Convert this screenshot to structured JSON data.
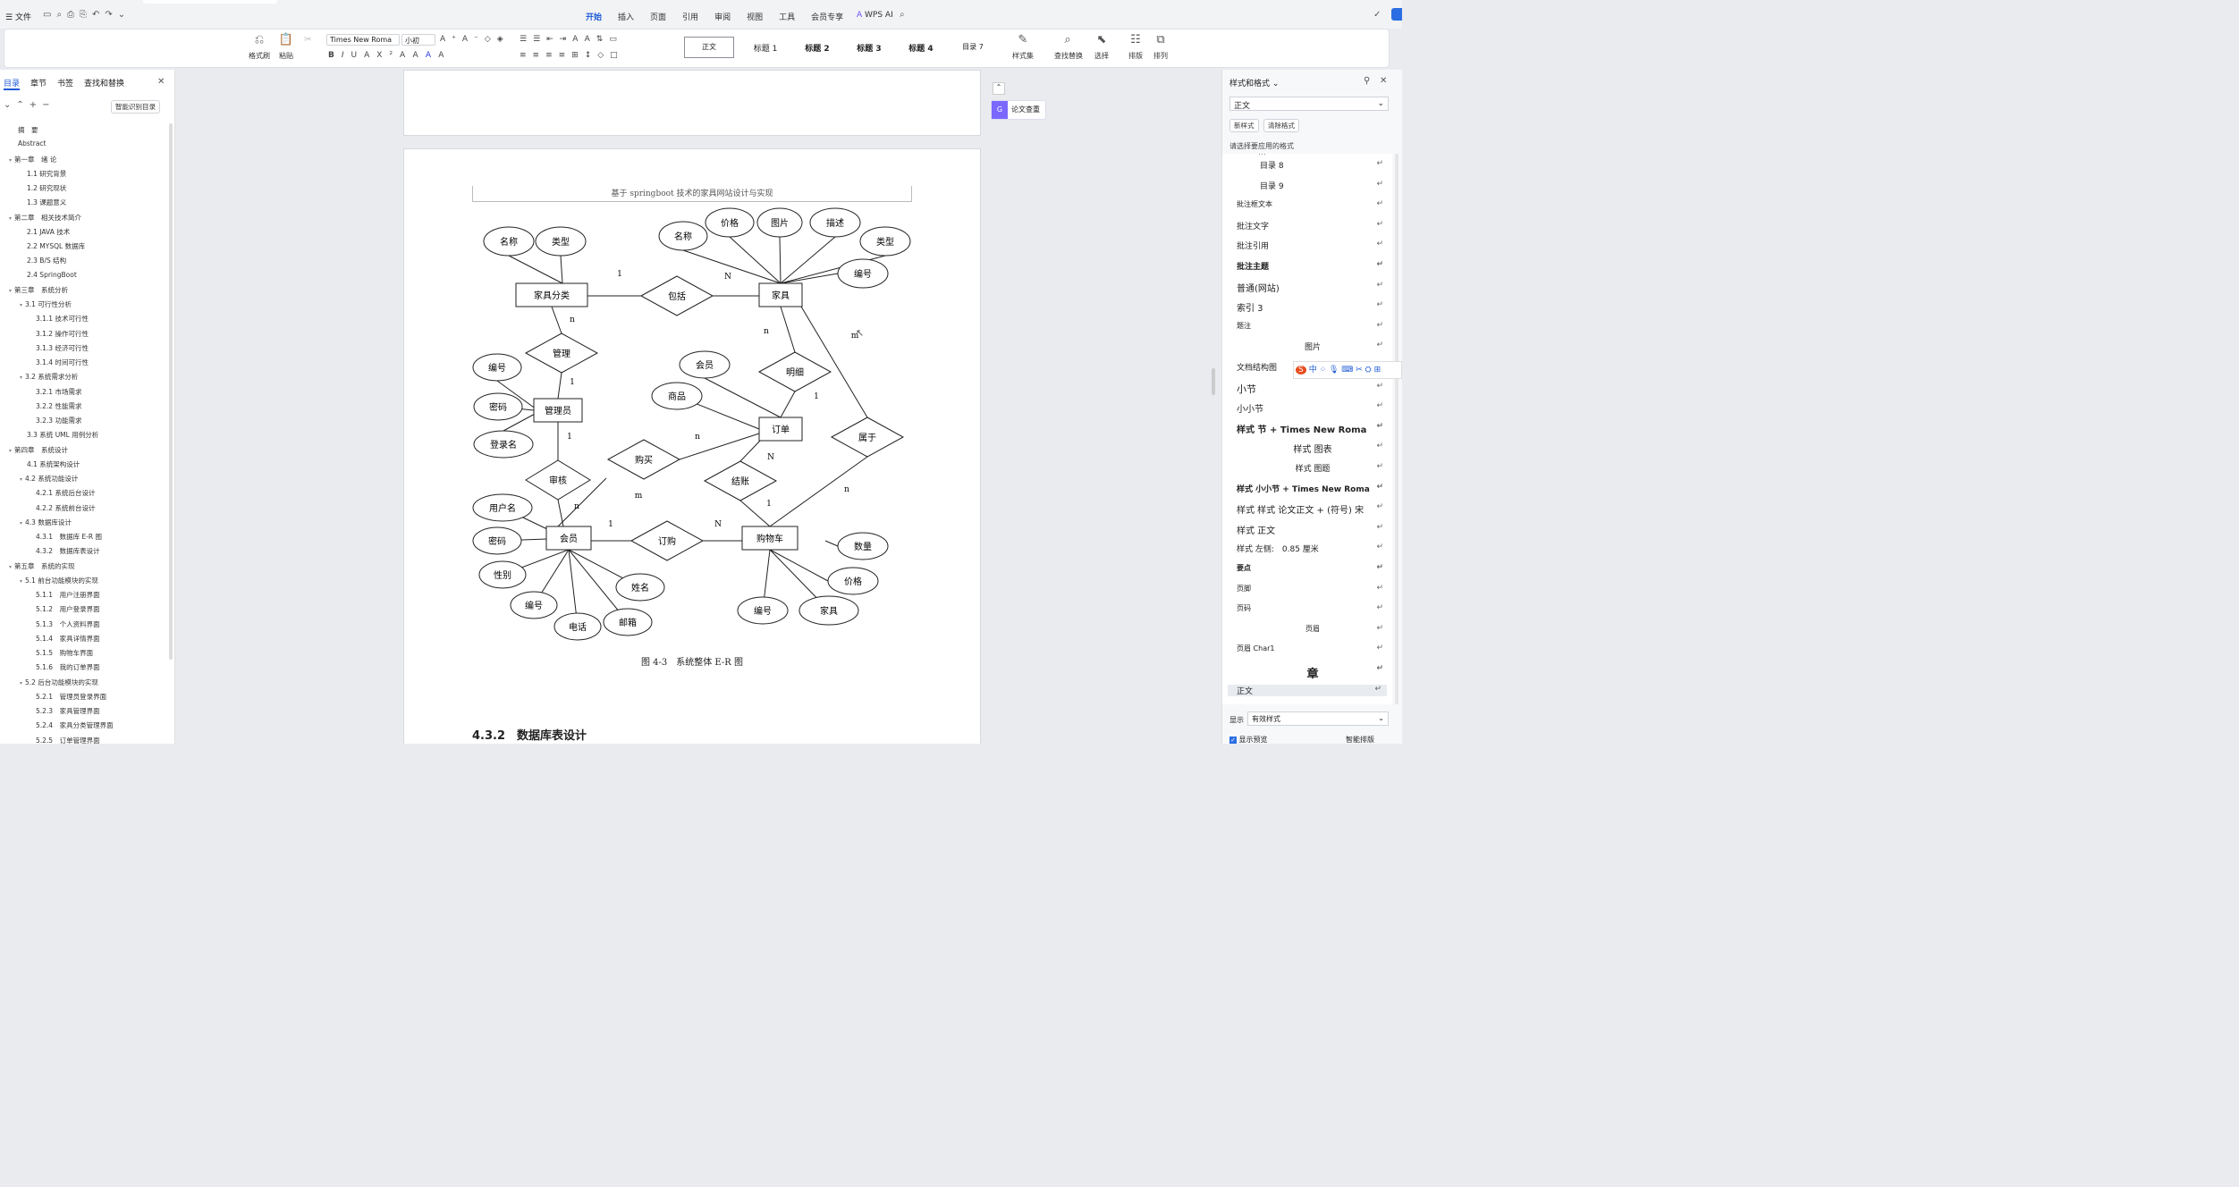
{
  "quickbar": {
    "file": "文件"
  },
  "menu_tabs": [
    "开始",
    "插入",
    "页面",
    "引用",
    "审阅",
    "视图",
    "工具",
    "会员专享"
  ],
  "wps_ai": "WPS AI",
  "ribbon": {
    "left_groups": [
      {
        "label": "格式刷",
        "icon": "format-painter-icon"
      },
      {
        "label": "粘贴",
        "icon": "paste-icon"
      }
    ],
    "font_name": "Times New Roma",
    "font_size": "小初",
    "styles": [
      "正文",
      "标题 1",
      "标题 2",
      "标题 3",
      "标题 4",
      "目录 7"
    ],
    "right_groups": [
      {
        "label": "样式集",
        "icon": "style-set-icon"
      },
      {
        "label": "查找替换",
        "icon": "search-icon"
      },
      {
        "label": "选择",
        "icon": "select-icon"
      },
      {
        "label": "排版",
        "icon": "layout-icon"
      },
      {
        "label": "排列",
        "icon": "arrange-icon"
      }
    ]
  },
  "nav": {
    "tabs": [
      "目录",
      "章节",
      "书签",
      "查找和替换"
    ],
    "smart_btn": "智能识别目录",
    "toc": [
      {
        "t": "摘　要",
        "l": 0,
        "c": ""
      },
      {
        "t": "Abstract",
        "l": 0,
        "c": ""
      },
      {
        "t": "第一章　绪 论",
        "l": 0,
        "c": "v"
      },
      {
        "t": "1.1 研究背景",
        "l": 1,
        "c": ""
      },
      {
        "t": "1.2 研究现状",
        "l": 1,
        "c": ""
      },
      {
        "t": "1.3 课题意义",
        "l": 1,
        "c": ""
      },
      {
        "t": "第二章　相关技术简介",
        "l": 0,
        "c": "v"
      },
      {
        "t": "2.1 JAVA 技术",
        "l": 1,
        "c": ""
      },
      {
        "t": "2.2 MYSQL 数据库",
        "l": 1,
        "c": ""
      },
      {
        "t": "2.3 B/S 结构",
        "l": 1,
        "c": ""
      },
      {
        "t": "2.4 SpringBoot",
        "l": 1,
        "c": ""
      },
      {
        "t": "第三章　系统分析",
        "l": 0,
        "c": "v"
      },
      {
        "t": "3.1 可行性分析",
        "l": 1,
        "c": "v"
      },
      {
        "t": "3.1.1 技术可行性",
        "l": 2,
        "c": ""
      },
      {
        "t": "3.1.2 操作可行性",
        "l": 2,
        "c": ""
      },
      {
        "t": "3.1.3 经济可行性",
        "l": 2,
        "c": ""
      },
      {
        "t": "3.1.4 时间可行性",
        "l": 2,
        "c": ""
      },
      {
        "t": "3.2 系统需求分析",
        "l": 1,
        "c": "v"
      },
      {
        "t": "3.2.1 市场需求",
        "l": 2,
        "c": ""
      },
      {
        "t": "3.2.2 性能需求",
        "l": 2,
        "c": ""
      },
      {
        "t": "3.2.3 功能需求",
        "l": 2,
        "c": ""
      },
      {
        "t": "3.3 系统 UML 用例分析",
        "l": 1,
        "c": ""
      },
      {
        "t": "第四章　系统设计",
        "l": 0,
        "c": "v"
      },
      {
        "t": "4.1 系统架构设计",
        "l": 1,
        "c": ""
      },
      {
        "t": "4.2 系统功能设计",
        "l": 1,
        "c": "v"
      },
      {
        "t": "4.2.1 系统后台设计",
        "l": 2,
        "c": ""
      },
      {
        "t": "4.2.2 系统前台设计",
        "l": 2,
        "c": ""
      },
      {
        "t": "4.3 数据库设计",
        "l": 1,
        "c": "v"
      },
      {
        "t": "4.3.1　数据库 E-R 图",
        "l": 2,
        "c": ""
      },
      {
        "t": "4.3.2　数据库表设计",
        "l": 2,
        "c": ""
      },
      {
        "t": "第五章　系统的实现",
        "l": 0,
        "c": "v"
      },
      {
        "t": "5.1 前台功能模块的实现",
        "l": 1,
        "c": "v"
      },
      {
        "t": "5.1.1　用户注册界面",
        "l": 2,
        "c": ""
      },
      {
        "t": "5.1.2　用户登录界面",
        "l": 2,
        "c": ""
      },
      {
        "t": "5.1.3　个人资料界面",
        "l": 2,
        "c": ""
      },
      {
        "t": "5.1.4　家具详情界面",
        "l": 2,
        "c": ""
      },
      {
        "t": "5.1.5　购物车界面",
        "l": 2,
        "c": ""
      },
      {
        "t": "5.1.6　我的订单界面",
        "l": 2,
        "c": ""
      },
      {
        "t": "5.2 后台功能模块的实现",
        "l": 1,
        "c": "v"
      },
      {
        "t": "5.2.1　管理员登录界面",
        "l": 2,
        "c": ""
      },
      {
        "t": "5.2.3　家具管理界面",
        "l": 2,
        "c": ""
      },
      {
        "t": "5.2.4　家具分类管理界面",
        "l": 2,
        "c": ""
      },
      {
        "t": "5.2.5　订单管理界面",
        "l": 2,
        "c": ""
      }
    ]
  },
  "doc": {
    "header": "基于 springboot 技术的家具网站设计与实现",
    "caption": "图 4-3　系统整体 E-R 图",
    "heading": "4.3.2　数据库表设计",
    "side_btn": "论文查重"
  },
  "er": {
    "entities": [
      [
        "家具分类",
        617,
        330,
        80,
        26
      ],
      [
        "家具",
        873,
        330,
        48,
        26
      ],
      [
        "管理员",
        624,
        459,
        54,
        26
      ],
      [
        "订单",
        873,
        480,
        48,
        26
      ],
      [
        "会员",
        636,
        602,
        50,
        26
      ],
      [
        "购物车",
        861,
        602,
        62,
        26
      ]
    ],
    "relations": [
      [
        "包括",
        757,
        331,
        80,
        44
      ],
      [
        "管理",
        628,
        395,
        80,
        44
      ],
      [
        "明细",
        889,
        416,
        80,
        44
      ],
      [
        "属于",
        970,
        489,
        80,
        44
      ],
      [
        "购买",
        720,
        514,
        80,
        44
      ],
      [
        "审核",
        624,
        537,
        72,
        44
      ],
      [
        "结账",
        828,
        538,
        80,
        44
      ],
      [
        "订购",
        746,
        605,
        80,
        44
      ]
    ],
    "attrs": [
      [
        "名称",
        569,
        270,
        56,
        32
      ],
      [
        "类型",
        627,
        270,
        56,
        32
      ],
      [
        "名称",
        764,
        264,
        54,
        32
      ],
      [
        "价格",
        816,
        249,
        54,
        32
      ],
      [
        "图片",
        872,
        249,
        50,
        32
      ],
      [
        "描述",
        934,
        249,
        56,
        32
      ],
      [
        "类型",
        990,
        270,
        56,
        32
      ],
      [
        "编号",
        965,
        306,
        56,
        32
      ],
      [
        "编号",
        556,
        411,
        54,
        30
      ],
      [
        "密码",
        557,
        455,
        54,
        30
      ],
      [
        "登录名",
        563,
        497,
        66,
        30
      ],
      [
        "会员",
        788,
        408,
        56,
        30
      ],
      [
        "商品",
        757,
        443,
        56,
        30
      ],
      [
        "用户名",
        562,
        568,
        66,
        30
      ],
      [
        "密码",
        556,
        605,
        54,
        30
      ],
      [
        "性别",
        562,
        643,
        52,
        30
      ],
      [
        "编号",
        597,
        677,
        52,
        30
      ],
      [
        "电话",
        646,
        701,
        52,
        30
      ],
      [
        "邮箱",
        702,
        696,
        54,
        30
      ],
      [
        "姓名",
        716,
        657,
        54,
        30
      ],
      [
        "数量",
        965,
        611,
        56,
        30
      ],
      [
        "价格",
        954,
        650,
        56,
        30
      ],
      [
        "编号",
        853,
        683,
        56,
        30
      ],
      [
        "家具",
        927,
        683,
        66,
        32
      ]
    ],
    "lines": [
      [
        569,
        286,
        629,
        317
      ],
      [
        627,
        286,
        629,
        317
      ],
      [
        657,
        331,
        717,
        331
      ],
      [
        797,
        331,
        849,
        331
      ],
      [
        764,
        280,
        873,
        317
      ],
      [
        816,
        265,
        873,
        317
      ],
      [
        872,
        265,
        873,
        317
      ],
      [
        934,
        265,
        873,
        317
      ],
      [
        990,
        286,
        873,
        317
      ],
      [
        937,
        306,
        873,
        317
      ],
      [
        617,
        343,
        628,
        373
      ],
      [
        628,
        417,
        624,
        446
      ],
      [
        556,
        426,
        600,
        458
      ],
      [
        557,
        455,
        597,
        459
      ],
      [
        563,
        482,
        600,
        462
      ],
      [
        624,
        472,
        624,
        515
      ],
      [
        624,
        559,
        630,
        589
      ],
      [
        678,
        535,
        624,
        589
      ],
      [
        760,
        514,
        849,
        485
      ],
      [
        788,
        423,
        873,
        467
      ],
      [
        757,
        443,
        849,
        480
      ],
      [
        873,
        343,
        889,
        394
      ],
      [
        889,
        438,
        873,
        467
      ],
      [
        896,
        343,
        970,
        467
      ],
      [
        970,
        511,
        861,
        589
      ],
      [
        828,
        560,
        861,
        589
      ],
      [
        850,
        493,
        828,
        516
      ],
      [
        660,
        605,
        706,
        605
      ],
      [
        786,
        605,
        830,
        605
      ],
      [
        562,
        568,
        612,
        592
      ],
      [
        556,
        605,
        612,
        603
      ],
      [
        562,
        643,
        636,
        615
      ],
      [
        597,
        677,
        636,
        615
      ],
      [
        646,
        701,
        636,
        615
      ],
      [
        702,
        696,
        636,
        615
      ],
      [
        716,
        657,
        636,
        615
      ],
      [
        923,
        605,
        937,
        611
      ],
      [
        926,
        650,
        861,
        615
      ],
      [
        853,
        683,
        861,
        615
      ],
      [
        927,
        683,
        861,
        615
      ]
    ],
    "labels": [
      [
        "1",
        693,
        309
      ],
      [
        "N",
        814,
        312
      ],
      [
        "n",
        640,
        360
      ],
      [
        "1",
        640,
        430
      ],
      [
        "n",
        857,
        373
      ],
      [
        "m",
        956,
        378
      ],
      [
        "1",
        913,
        446
      ],
      [
        "1",
        637,
        491
      ],
      [
        "n",
        780,
        491
      ],
      [
        "N",
        862,
        514
      ],
      [
        "m",
        714,
        557
      ],
      [
        "n",
        645,
        569
      ],
      [
        "n",
        947,
        550
      ],
      [
        "1",
        860,
        566
      ],
      [
        "1",
        683,
        589
      ],
      [
        "N",
        803,
        589
      ]
    ]
  },
  "right": {
    "title": "样式和格式",
    "current": "正文",
    "new_btn": "新样式",
    "clear_btn": "清除格式",
    "hint": "请选择要应用的格式",
    "items": [
      {
        "t": "目录 8",
        "i": 1,
        "w": "",
        "s": 9
      },
      {
        "t": "目录 9",
        "i": 1,
        "w": "",
        "s": 9
      },
      {
        "t": "批注框文本",
        "i": 0,
        "w": "",
        "s": 8
      },
      {
        "t": "批注文字",
        "i": 0,
        "w": "",
        "s": 9
      },
      {
        "t": "批注引用",
        "i": 0,
        "w": "",
        "s": 9
      },
      {
        "t": "批注主题",
        "i": 0,
        "w": "bold",
        "s": 9
      },
      {
        "t": "普通(网站)",
        "i": 0,
        "w": "",
        "s": 10
      },
      {
        "t": "索引 3",
        "i": 0,
        "w": "",
        "s": 10
      },
      {
        "t": "题注",
        "i": 0,
        "w": "",
        "s": 8
      },
      {
        "t": "图片",
        "i": 2,
        "w": "",
        "s": 9
      },
      {
        "t": "文档结构图",
        "i": 0,
        "w": "",
        "s": 9
      },
      {
        "t": "小节",
        "i": 0,
        "w": "",
        "s": 11
      },
      {
        "t": "小小节",
        "i": 0,
        "w": "",
        "s": 10
      },
      {
        "t": "样式 节 + Times New Roma",
        "i": 0,
        "w": "bold",
        "s": 10
      },
      {
        "t": "样式 图表",
        "i": 2,
        "w": "",
        "s": 10
      },
      {
        "t": "样式 图题",
        "i": 2,
        "w": "",
        "s": 9
      },
      {
        "t": "样式 小小节 + Times New Roma",
        "i": 0,
        "w": "bold",
        "s": 9
      },
      {
        "t": "样式 样式 论文正文 + (符号) 宋",
        "i": 0,
        "w": "",
        "s": 10
      },
      {
        "t": "样式 正文",
        "i": 0,
        "w": "",
        "s": 10
      },
      {
        "t": "样式 左侧:　0.85 厘米",
        "i": 0,
        "w": "",
        "s": 9
      },
      {
        "t": "要点",
        "i": 0,
        "w": "bold",
        "s": 8
      },
      {
        "t": "页脚",
        "i": 0,
        "w": "",
        "s": 8
      },
      {
        "t": "页码",
        "i": 0,
        "w": "",
        "s": 8
      },
      {
        "t": "页眉",
        "i": 2,
        "w": "",
        "s": 8
      },
      {
        "t": "页眉 Char1",
        "i": 0,
        "w": "",
        "s": 8
      },
      {
        "t": "章",
        "i": 2,
        "w": "bold",
        "s": 13
      },
      {
        "t": "正文",
        "i": 0,
        "w": "",
        "s": 9
      }
    ],
    "show_label": "显示",
    "show_value": "有效样式",
    "preview": "显示预览",
    "smart": "智能排版"
  },
  "ime": "中"
}
